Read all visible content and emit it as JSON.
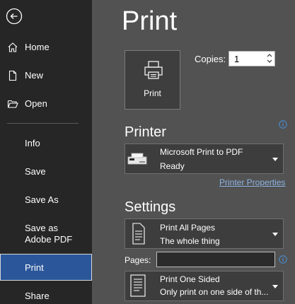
{
  "sidebar": {
    "back_label": "Back",
    "items": [
      {
        "label": "Home",
        "icon": "home-icon"
      },
      {
        "label": "New",
        "icon": "new-document-icon"
      },
      {
        "label": "Open",
        "icon": "open-folder-icon"
      },
      {
        "label": "Info"
      },
      {
        "label": "Save"
      },
      {
        "label": "Save As"
      },
      {
        "label": "Save as Adobe PDF"
      },
      {
        "label": "Print",
        "selected": true
      },
      {
        "label": "Share"
      }
    ]
  },
  "main": {
    "title": "Print",
    "print_button_label": "Print",
    "copies": {
      "label": "Copies:",
      "value": "1"
    },
    "printer": {
      "heading": "Printer",
      "name": "Microsoft Print to PDF",
      "status": "Ready",
      "properties_link": "Printer Properties"
    },
    "settings": {
      "heading": "Settings",
      "range": {
        "main": "Print All Pages",
        "sub": "The whole thing"
      },
      "pages_label": "Pages:",
      "pages_value": "",
      "sides": {
        "main": "Print One Sided",
        "sub": "Only print on one side of th..."
      }
    }
  },
  "colors": {
    "sidebar_bg": "#262626",
    "main_bg": "#525252",
    "selected_bg": "#2b579a",
    "link": "#8db3e2",
    "info": "#4a90d9"
  }
}
